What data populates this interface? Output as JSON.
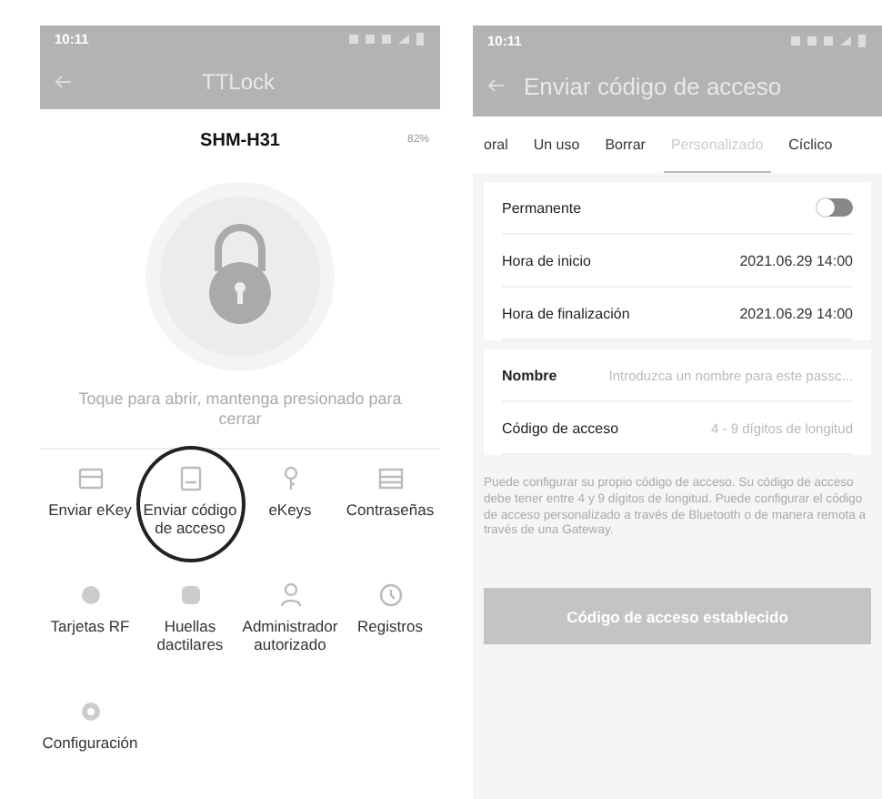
{
  "left_screen": {
    "status_bar": {
      "time": "10:11"
    },
    "header": {
      "title": "TTLock"
    },
    "device": {
      "name": "SHM-H31",
      "battery": "82%"
    },
    "hint": "Toque para abrir, mantenga presionado para cerrar",
    "menu": [
      {
        "label": "Enviar eKey",
        "circled": false
      },
      {
        "label": "Enviar código de acceso",
        "circled": true
      },
      {
        "label": "eKeys",
        "circled": false
      },
      {
        "label": "Contraseñas",
        "circled": false
      },
      {
        "label": "Tarjetas RF",
        "circled": false
      },
      {
        "label": "Huellas dactilares",
        "circled": false
      },
      {
        "label": "Administrador autorizado",
        "circled": false
      },
      {
        "label": "Registros",
        "circled": false
      },
      {
        "label": "Configuración",
        "circled": false
      }
    ]
  },
  "right_screen": {
    "status_bar": {
      "time": "10:11"
    },
    "header": {
      "title": "Enviar código de acceso"
    },
    "tabs": [
      {
        "label": "oral",
        "selected": false
      },
      {
        "label": "Un uso",
        "selected": false
      },
      {
        "label": "Borrar",
        "selected": false
      },
      {
        "label": "Personalizado",
        "selected": true
      },
      {
        "label": "Cíclico",
        "selected": false
      }
    ],
    "time_card": {
      "permanent": {
        "label": "Permanente",
        "on": false
      },
      "rows": [
        {
          "label": "Hora de inicio",
          "value": "2021.06.29 14:00"
        },
        {
          "label": "Hora de finalización",
          "value": "2021.06.29 14:00"
        }
      ]
    },
    "code_card": {
      "name": {
        "label": "Nombre",
        "placeholder": "Introduzca un nombre para este passc..."
      },
      "code": {
        "label": "Código de acceso",
        "placeholder": "4 - 9 dígitos de longitud"
      }
    },
    "note": "Puede configurar su propio código de acceso. Su código de acceso debe tener entre 4 y 9 dígitos de longitud. Puede configurar el código de acceso personalizado a través de Bluetooth o de manera remota a través de una Gateway.",
    "button": {
      "label": "Código de acceso establecido",
      "disabled": true
    }
  }
}
